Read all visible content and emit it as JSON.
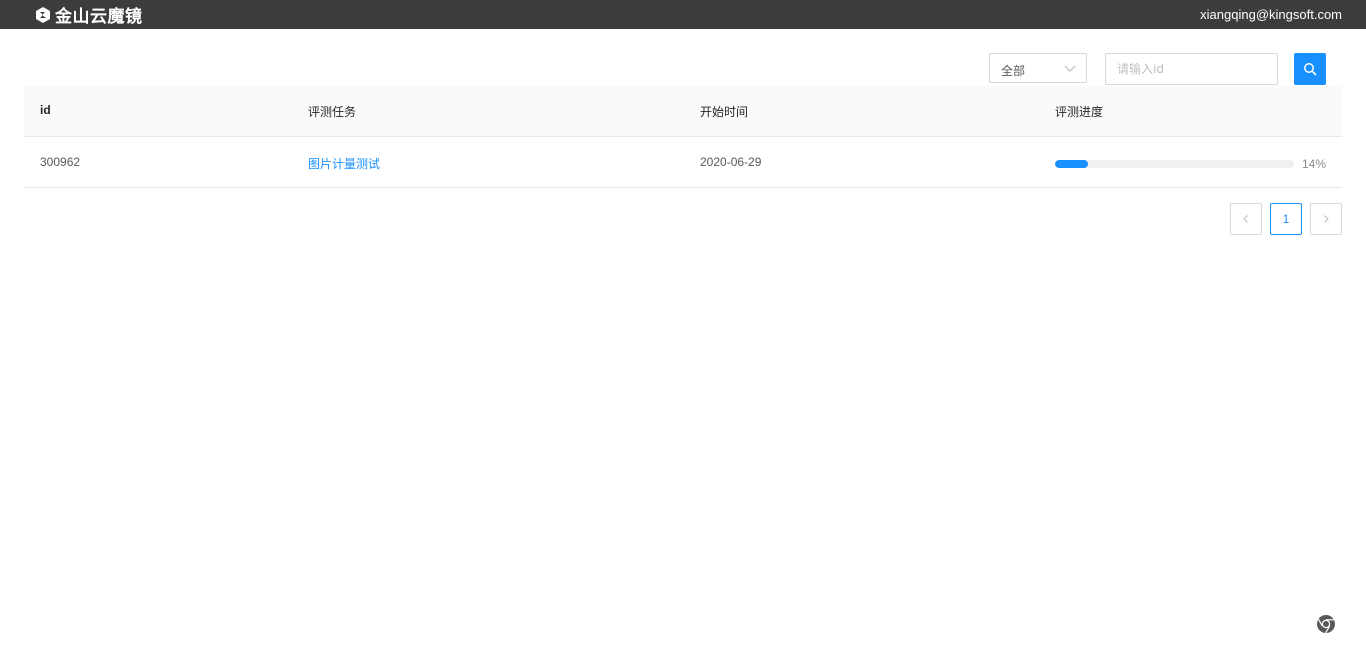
{
  "header": {
    "logo_text": "金山云魔镜",
    "user_email": "xiangqing@kingsoft.com"
  },
  "filters": {
    "select_value": "全部",
    "search_placeholder": "请输入id",
    "search_value": ""
  },
  "table": {
    "columns": [
      "id",
      "评测任务",
      "开始时间",
      "评测进度"
    ],
    "rows": [
      {
        "id": "300962",
        "task": "图片计量测试",
        "start_time": "2020-06-29",
        "progress": 14,
        "progress_label": "14%"
      }
    ]
  },
  "pagination": {
    "current": "1"
  },
  "colors": {
    "topbar": "#3c3c3c",
    "accent": "#1890ff"
  },
  "icons": {
    "logo": "logo-mark-icon",
    "select": "chevron-down-icon",
    "search": "search-icon",
    "prev": "chevron-left-icon",
    "next": "chevron-right-icon",
    "corner": "chrome-icon"
  }
}
